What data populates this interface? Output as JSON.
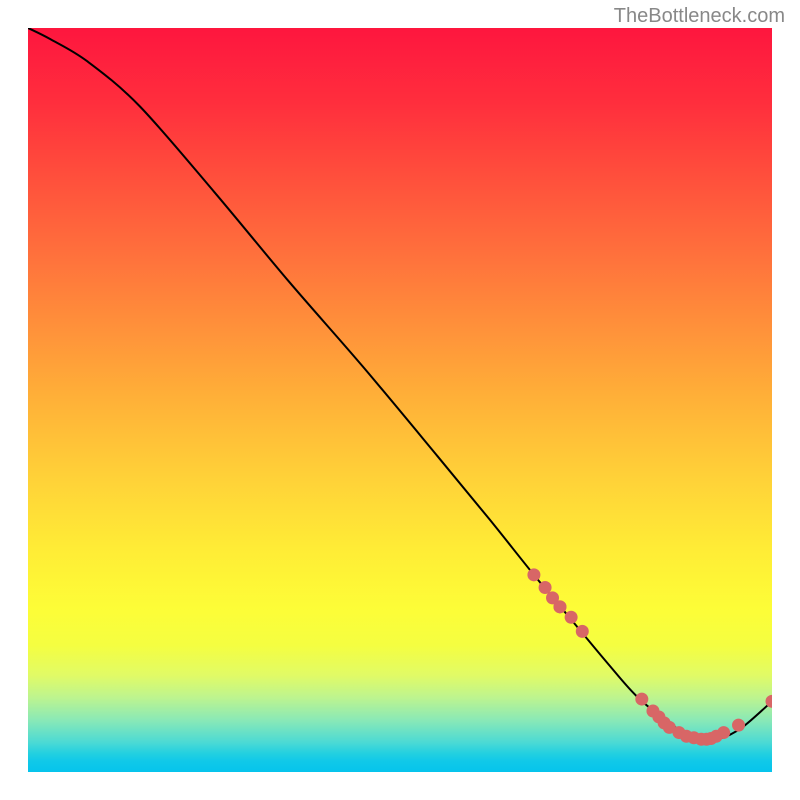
{
  "watermark": "TheBottleneck.com",
  "chart_data": {
    "type": "line",
    "x": [
      0,
      0.03,
      0.08,
      0.15,
      0.25,
      0.35,
      0.45,
      0.55,
      0.62,
      0.68,
      0.73,
      0.78,
      0.82,
      0.87,
      0.9,
      0.93,
      0.96,
      1.0
    ],
    "values": [
      1.0,
      0.985,
      0.955,
      0.895,
      0.78,
      0.66,
      0.545,
      0.425,
      0.34,
      0.265,
      0.205,
      0.145,
      0.1,
      0.06,
      0.045,
      0.045,
      0.06,
      0.095
    ],
    "points": [
      {
        "x": 0.68,
        "y": 0.265
      },
      {
        "x": 0.695,
        "y": 0.248
      },
      {
        "x": 0.705,
        "y": 0.234
      },
      {
        "x": 0.715,
        "y": 0.222
      },
      {
        "x": 0.715,
        "y": 0.222
      },
      {
        "x": 0.73,
        "y": 0.208
      },
      {
        "x": 0.745,
        "y": 0.189
      },
      {
        "x": 0.825,
        "y": 0.098
      },
      {
        "x": 0.84,
        "y": 0.082
      },
      {
        "x": 0.848,
        "y": 0.074
      },
      {
        "x": 0.855,
        "y": 0.066
      },
      {
        "x": 0.862,
        "y": 0.06
      },
      {
        "x": 0.875,
        "y": 0.053
      },
      {
        "x": 0.885,
        "y": 0.048
      },
      {
        "x": 0.895,
        "y": 0.046
      },
      {
        "x": 0.905,
        "y": 0.044
      },
      {
        "x": 0.912,
        "y": 0.044
      },
      {
        "x": 0.918,
        "y": 0.045
      },
      {
        "x": 0.925,
        "y": 0.048
      },
      {
        "x": 0.935,
        "y": 0.053
      },
      {
        "x": 0.955,
        "y": 0.063
      },
      {
        "x": 1.0,
        "y": 0.095
      }
    ],
    "gradient_stops": [
      {
        "offset": 0.0,
        "color": "#fe163e"
      },
      {
        "offset": 0.1,
        "color": "#ff2e3d"
      },
      {
        "offset": 0.2,
        "color": "#ff4f3c"
      },
      {
        "offset": 0.3,
        "color": "#ff6f3c"
      },
      {
        "offset": 0.4,
        "color": "#ff903a"
      },
      {
        "offset": 0.5,
        "color": "#ffb138"
      },
      {
        "offset": 0.6,
        "color": "#ffd038"
      },
      {
        "offset": 0.7,
        "color": "#ffec36"
      },
      {
        "offset": 0.78,
        "color": "#fdfd37"
      },
      {
        "offset": 0.83,
        "color": "#f4fe41"
      },
      {
        "offset": 0.87,
        "color": "#e1fb66"
      },
      {
        "offset": 0.9,
        "color": "#bdf48f"
      },
      {
        "offset": 0.93,
        "color": "#8ae9b6"
      },
      {
        "offset": 0.96,
        "color": "#4cdad4"
      },
      {
        "offset": 0.975,
        "color": "#23d0e0"
      },
      {
        "offset": 0.985,
        "color": "#11c9e8"
      },
      {
        "offset": 1.0,
        "color": "#06c4ec"
      }
    ],
    "point_color": "#d86666",
    "line_color": "#000000",
    "xlim": [
      0,
      1
    ],
    "ylim": [
      0,
      1
    ]
  }
}
